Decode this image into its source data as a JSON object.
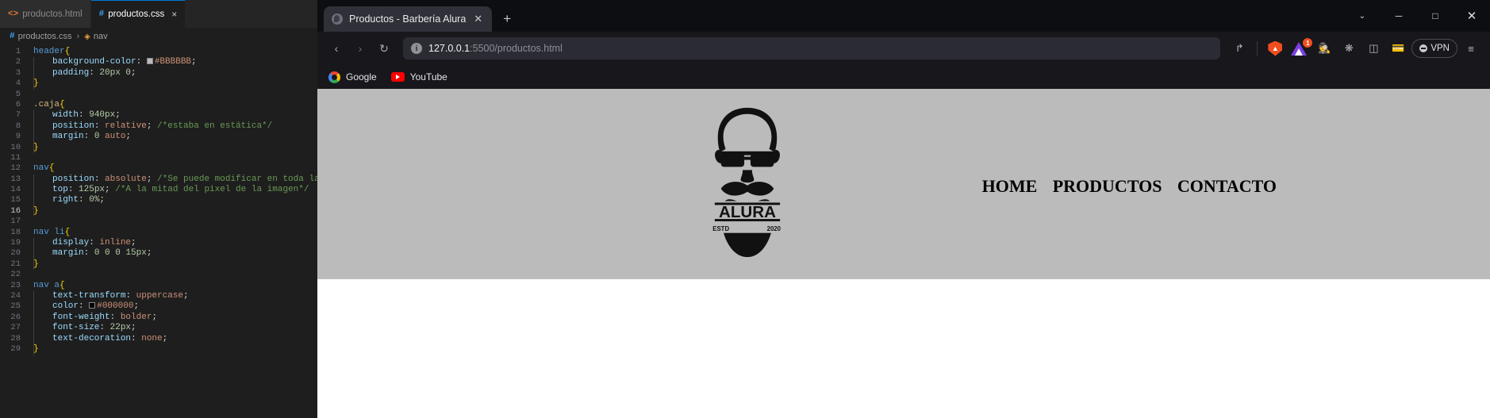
{
  "editor": {
    "tabs": [
      {
        "label": "productos.html",
        "icon": "html-file-icon",
        "active": false
      },
      {
        "label": "productos.css",
        "icon": "css-file-icon",
        "active": true,
        "close": "×"
      }
    ],
    "breadcrumb": {
      "file": "productos.css",
      "separator": "›",
      "symbol": "nav"
    },
    "lines": [
      {
        "n": "1",
        "tokens": [
          {
            "t": "header",
            "c": "sel"
          },
          {
            "t": "{",
            "c": "brace"
          }
        ]
      },
      {
        "n": "2",
        "indent": 1,
        "tokens": [
          {
            "t": "background-color",
            "c": "prop"
          },
          {
            "t": ": ",
            "c": "punc"
          },
          {
            "t": "#BBBBBB",
            "c": "val",
            "swatch": "#BBBBBB"
          },
          {
            "t": ";",
            "c": "punc"
          }
        ]
      },
      {
        "n": "3",
        "indent": 1,
        "tokens": [
          {
            "t": "padding",
            "c": "prop"
          },
          {
            "t": ": ",
            "c": "punc"
          },
          {
            "t": "20px 0",
            "c": "num"
          },
          {
            "t": ";",
            "c": "punc"
          }
        ]
      },
      {
        "n": "4",
        "tokens": [
          {
            "t": "}",
            "c": "brace"
          }
        ]
      },
      {
        "n": "5",
        "tokens": []
      },
      {
        "n": "6",
        "tokens": [
          {
            "t": ".caja",
            "c": "tagname"
          },
          {
            "t": "{",
            "c": "brace"
          }
        ]
      },
      {
        "n": "7",
        "indent": 1,
        "tokens": [
          {
            "t": "width",
            "c": "prop"
          },
          {
            "t": ": ",
            "c": "punc"
          },
          {
            "t": "940px",
            "c": "num"
          },
          {
            "t": ";",
            "c": "punc"
          }
        ]
      },
      {
        "n": "8",
        "indent": 1,
        "tokens": [
          {
            "t": "position",
            "c": "prop"
          },
          {
            "t": ": ",
            "c": "punc"
          },
          {
            "t": "relative",
            "c": "val"
          },
          {
            "t": "; ",
            "c": "punc"
          },
          {
            "t": "/*estaba en estática*/",
            "c": "cmt"
          }
        ]
      },
      {
        "n": "9",
        "indent": 1,
        "tokens": [
          {
            "t": "margin",
            "c": "prop"
          },
          {
            "t": ": ",
            "c": "punc"
          },
          {
            "t": "0 ",
            "c": "num"
          },
          {
            "t": "auto",
            "c": "val"
          },
          {
            "t": ";",
            "c": "punc"
          }
        ]
      },
      {
        "n": "10",
        "tokens": [
          {
            "t": "}",
            "c": "brace"
          }
        ]
      },
      {
        "n": "11",
        "tokens": []
      },
      {
        "n": "12",
        "tokens": [
          {
            "t": "nav",
            "c": "sel"
          },
          {
            "t": "{",
            "c": "brace"
          }
        ]
      },
      {
        "n": "13",
        "indent": 1,
        "tokens": [
          {
            "t": "position",
            "c": "prop"
          },
          {
            "t": ": ",
            "c": "punc"
          },
          {
            "t": "absolute",
            "c": "val"
          },
          {
            "t": "; ",
            "c": "punc"
          },
          {
            "t": "/*Se puede modificar en toda la página, re",
            "c": "cmt"
          }
        ]
      },
      {
        "n": "14",
        "indent": 1,
        "tokens": [
          {
            "t": "top",
            "c": "prop"
          },
          {
            "t": ": ",
            "c": "punc"
          },
          {
            "t": "125px",
            "c": "num"
          },
          {
            "t": "; ",
            "c": "punc"
          },
          {
            "t": "/*A la mitad del pixel de la imagen*/",
            "c": "cmt"
          }
        ]
      },
      {
        "n": "15",
        "indent": 1,
        "tokens": [
          {
            "t": "right",
            "c": "prop"
          },
          {
            "t": ": ",
            "c": "punc"
          },
          {
            "t": "0%",
            "c": "num"
          },
          {
            "t": ";",
            "c": "punc"
          }
        ]
      },
      {
        "n": "16",
        "current": true,
        "tokens": [
          {
            "t": "}",
            "c": "brace"
          }
        ]
      },
      {
        "n": "17",
        "tokens": []
      },
      {
        "n": "18",
        "tokens": [
          {
            "t": "nav li",
            "c": "sel"
          },
          {
            "t": "{",
            "c": "brace"
          }
        ]
      },
      {
        "n": "19",
        "indent": 1,
        "tokens": [
          {
            "t": "display",
            "c": "prop"
          },
          {
            "t": ": ",
            "c": "punc"
          },
          {
            "t": "inline",
            "c": "val"
          },
          {
            "t": ";",
            "c": "punc"
          }
        ]
      },
      {
        "n": "20",
        "indent": 1,
        "tokens": [
          {
            "t": "margin",
            "c": "prop"
          },
          {
            "t": ": ",
            "c": "punc"
          },
          {
            "t": "0 0 0 15px",
            "c": "num"
          },
          {
            "t": ";",
            "c": "punc"
          }
        ]
      },
      {
        "n": "21",
        "tokens": [
          {
            "t": "}",
            "c": "brace"
          }
        ]
      },
      {
        "n": "22",
        "tokens": []
      },
      {
        "n": "23",
        "tokens": [
          {
            "t": "nav a",
            "c": "sel"
          },
          {
            "t": "{",
            "c": "brace"
          }
        ]
      },
      {
        "n": "24",
        "indent": 1,
        "tokens": [
          {
            "t": "text-transform",
            "c": "prop"
          },
          {
            "t": ": ",
            "c": "punc"
          },
          {
            "t": "uppercase",
            "c": "val"
          },
          {
            "t": ";",
            "c": "punc"
          }
        ]
      },
      {
        "n": "25",
        "indent": 1,
        "tokens": [
          {
            "t": "color",
            "c": "prop"
          },
          {
            "t": ": ",
            "c": "punc"
          },
          {
            "t": "#000000",
            "c": "val",
            "swatch": "#000000"
          },
          {
            "t": ";",
            "c": "punc"
          }
        ]
      },
      {
        "n": "26",
        "indent": 1,
        "tokens": [
          {
            "t": "font-weight",
            "c": "prop"
          },
          {
            "t": ": ",
            "c": "punc"
          },
          {
            "t": "bolder",
            "c": "val"
          },
          {
            "t": ";",
            "c": "punc"
          }
        ]
      },
      {
        "n": "27",
        "indent": 1,
        "tokens": [
          {
            "t": "font-size",
            "c": "prop"
          },
          {
            "t": ": ",
            "c": "punc"
          },
          {
            "t": "22px",
            "c": "num"
          },
          {
            "t": ";",
            "c": "punc"
          }
        ]
      },
      {
        "n": "28",
        "indent": 1,
        "tokens": [
          {
            "t": "text-decoration",
            "c": "prop"
          },
          {
            "t": ": ",
            "c": "punc"
          },
          {
            "t": "none",
            "c": "val"
          },
          {
            "t": ";",
            "c": "punc"
          }
        ]
      },
      {
        "n": "29",
        "tokens": [
          {
            "t": "}",
            "c": "brace"
          }
        ]
      }
    ]
  },
  "browser": {
    "tab": {
      "title": "Productos - Barbería Alura",
      "close_label": "✕"
    },
    "new_tab_label": "+",
    "window_controls": {
      "minimize_chevron": "⌄",
      "minimize": "─",
      "maximize": "□",
      "close": "✕"
    },
    "toolbar": {
      "back": "‹",
      "forward": "›",
      "reload": "↻",
      "bookmark": "☆",
      "url_host": "127.0.0.1",
      "url_rest": ":5500/productos.html",
      "share": "↱",
      "brave_shield_label": "🦁",
      "notification_badge": "1",
      "vpn_label": "VPN",
      "menu": "≡"
    },
    "bookmarks": [
      {
        "label": "Google",
        "icon": "google-icon"
      },
      {
        "label": "YouTube",
        "icon": "youtube-icon"
      }
    ]
  },
  "page": {
    "logo": {
      "word": "ALURA",
      "estd": "ESTD",
      "year": "2020"
    },
    "nav": [
      {
        "label": "HOME"
      },
      {
        "label": "PRODUCTOS"
      },
      {
        "label": "CONTACTO"
      }
    ],
    "header_bg": "#BBBBBB"
  }
}
